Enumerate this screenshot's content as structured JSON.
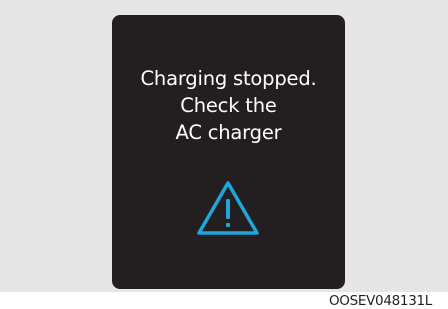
{
  "display": {
    "message_lines": [
      "Charging stopped.",
      "Check the",
      "AC charger"
    ],
    "icon": "warning-triangle-icon",
    "background_color": "#231f20",
    "text_color": "#ffffff",
    "icon_color": "#1ea7dc"
  },
  "figure_code": "OOSEV048131L"
}
